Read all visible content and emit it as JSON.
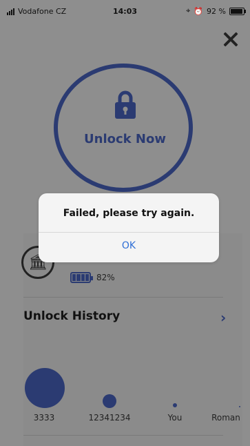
{
  "status_bar": {
    "carrier": "Vodafone CZ",
    "time": "14:03",
    "battery": "92 %"
  },
  "unlock": {
    "label": "Unlock Now"
  },
  "lock_status": {
    "battery_percent": "82%"
  },
  "history": {
    "title": "Unlock History",
    "users": [
      {
        "name": "3333"
      },
      {
        "name": "12341234"
      },
      {
        "name": "You"
      },
      {
        "name": "Roman"
      }
    ]
  },
  "alert": {
    "message": "Failed, please try again.",
    "ok_label": "OK"
  },
  "colors": {
    "accent": "#2b3b72",
    "overlay_bg": "#8e8e8e",
    "alert_button": "#2f6fd6"
  }
}
